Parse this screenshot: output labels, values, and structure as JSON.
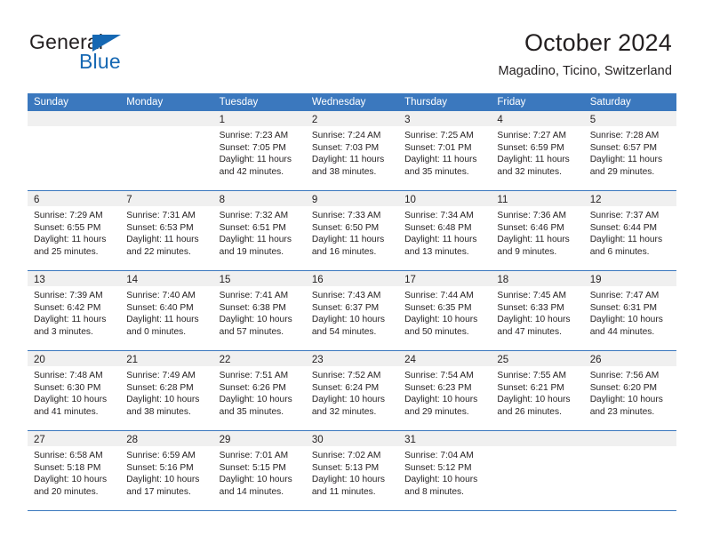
{
  "brand": {
    "name_top": "General",
    "name_bottom": "Blue",
    "accent_color": "#1668b3"
  },
  "header": {
    "title": "October 2024",
    "subtitle": "Magadino, Ticino, Switzerland"
  },
  "theme": {
    "header_row_color": "#3b78be",
    "daynum_band_color": "#f0f0f0",
    "text_color": "#231f20"
  },
  "weekdays": [
    "Sunday",
    "Monday",
    "Tuesday",
    "Wednesday",
    "Thursday",
    "Friday",
    "Saturday"
  ],
  "labels": {
    "sunrise_prefix": "Sunrise:",
    "sunset_prefix": "Sunset:",
    "daylight_prefix": "Daylight:"
  },
  "weeks": [
    [
      {
        "day": "",
        "sunrise": "",
        "sunset": "",
        "daylight_line1": "",
        "daylight_line2": ""
      },
      {
        "day": "",
        "sunrise": "",
        "sunset": "",
        "daylight_line1": "",
        "daylight_line2": ""
      },
      {
        "day": "1",
        "sunrise": "Sunrise: 7:23 AM",
        "sunset": "Sunset: 7:05 PM",
        "daylight_line1": "Daylight: 11 hours",
        "daylight_line2": "and 42 minutes."
      },
      {
        "day": "2",
        "sunrise": "Sunrise: 7:24 AM",
        "sunset": "Sunset: 7:03 PM",
        "daylight_line1": "Daylight: 11 hours",
        "daylight_line2": "and 38 minutes."
      },
      {
        "day": "3",
        "sunrise": "Sunrise: 7:25 AM",
        "sunset": "Sunset: 7:01 PM",
        "daylight_line1": "Daylight: 11 hours",
        "daylight_line2": "and 35 minutes."
      },
      {
        "day": "4",
        "sunrise": "Sunrise: 7:27 AM",
        "sunset": "Sunset: 6:59 PM",
        "daylight_line1": "Daylight: 11 hours",
        "daylight_line2": "and 32 minutes."
      },
      {
        "day": "5",
        "sunrise": "Sunrise: 7:28 AM",
        "sunset": "Sunset: 6:57 PM",
        "daylight_line1": "Daylight: 11 hours",
        "daylight_line2": "and 29 minutes."
      }
    ],
    [
      {
        "day": "6",
        "sunrise": "Sunrise: 7:29 AM",
        "sunset": "Sunset: 6:55 PM",
        "daylight_line1": "Daylight: 11 hours",
        "daylight_line2": "and 25 minutes."
      },
      {
        "day": "7",
        "sunrise": "Sunrise: 7:31 AM",
        "sunset": "Sunset: 6:53 PM",
        "daylight_line1": "Daylight: 11 hours",
        "daylight_line2": "and 22 minutes."
      },
      {
        "day": "8",
        "sunrise": "Sunrise: 7:32 AM",
        "sunset": "Sunset: 6:51 PM",
        "daylight_line1": "Daylight: 11 hours",
        "daylight_line2": "and 19 minutes."
      },
      {
        "day": "9",
        "sunrise": "Sunrise: 7:33 AM",
        "sunset": "Sunset: 6:50 PM",
        "daylight_line1": "Daylight: 11 hours",
        "daylight_line2": "and 16 minutes."
      },
      {
        "day": "10",
        "sunrise": "Sunrise: 7:34 AM",
        "sunset": "Sunset: 6:48 PM",
        "daylight_line1": "Daylight: 11 hours",
        "daylight_line2": "and 13 minutes."
      },
      {
        "day": "11",
        "sunrise": "Sunrise: 7:36 AM",
        "sunset": "Sunset: 6:46 PM",
        "daylight_line1": "Daylight: 11 hours",
        "daylight_line2": "and 9 minutes."
      },
      {
        "day": "12",
        "sunrise": "Sunrise: 7:37 AM",
        "sunset": "Sunset: 6:44 PM",
        "daylight_line1": "Daylight: 11 hours",
        "daylight_line2": "and 6 minutes."
      }
    ],
    [
      {
        "day": "13",
        "sunrise": "Sunrise: 7:39 AM",
        "sunset": "Sunset: 6:42 PM",
        "daylight_line1": "Daylight: 11 hours",
        "daylight_line2": "and 3 minutes."
      },
      {
        "day": "14",
        "sunrise": "Sunrise: 7:40 AM",
        "sunset": "Sunset: 6:40 PM",
        "daylight_line1": "Daylight: 11 hours",
        "daylight_line2": "and 0 minutes."
      },
      {
        "day": "15",
        "sunrise": "Sunrise: 7:41 AM",
        "sunset": "Sunset: 6:38 PM",
        "daylight_line1": "Daylight: 10 hours",
        "daylight_line2": "and 57 minutes."
      },
      {
        "day": "16",
        "sunrise": "Sunrise: 7:43 AM",
        "sunset": "Sunset: 6:37 PM",
        "daylight_line1": "Daylight: 10 hours",
        "daylight_line2": "and 54 minutes."
      },
      {
        "day": "17",
        "sunrise": "Sunrise: 7:44 AM",
        "sunset": "Sunset: 6:35 PM",
        "daylight_line1": "Daylight: 10 hours",
        "daylight_line2": "and 50 minutes."
      },
      {
        "day": "18",
        "sunrise": "Sunrise: 7:45 AM",
        "sunset": "Sunset: 6:33 PM",
        "daylight_line1": "Daylight: 10 hours",
        "daylight_line2": "and 47 minutes."
      },
      {
        "day": "19",
        "sunrise": "Sunrise: 7:47 AM",
        "sunset": "Sunset: 6:31 PM",
        "daylight_line1": "Daylight: 10 hours",
        "daylight_line2": "and 44 minutes."
      }
    ],
    [
      {
        "day": "20",
        "sunrise": "Sunrise: 7:48 AM",
        "sunset": "Sunset: 6:30 PM",
        "daylight_line1": "Daylight: 10 hours",
        "daylight_line2": "and 41 minutes."
      },
      {
        "day": "21",
        "sunrise": "Sunrise: 7:49 AM",
        "sunset": "Sunset: 6:28 PM",
        "daylight_line1": "Daylight: 10 hours",
        "daylight_line2": "and 38 minutes."
      },
      {
        "day": "22",
        "sunrise": "Sunrise: 7:51 AM",
        "sunset": "Sunset: 6:26 PM",
        "daylight_line1": "Daylight: 10 hours",
        "daylight_line2": "and 35 minutes."
      },
      {
        "day": "23",
        "sunrise": "Sunrise: 7:52 AM",
        "sunset": "Sunset: 6:24 PM",
        "daylight_line1": "Daylight: 10 hours",
        "daylight_line2": "and 32 minutes."
      },
      {
        "day": "24",
        "sunrise": "Sunrise: 7:54 AM",
        "sunset": "Sunset: 6:23 PM",
        "daylight_line1": "Daylight: 10 hours",
        "daylight_line2": "and 29 minutes."
      },
      {
        "day": "25",
        "sunrise": "Sunrise: 7:55 AM",
        "sunset": "Sunset: 6:21 PM",
        "daylight_line1": "Daylight: 10 hours",
        "daylight_line2": "and 26 minutes."
      },
      {
        "day": "26",
        "sunrise": "Sunrise: 7:56 AM",
        "sunset": "Sunset: 6:20 PM",
        "daylight_line1": "Daylight: 10 hours",
        "daylight_line2": "and 23 minutes."
      }
    ],
    [
      {
        "day": "27",
        "sunrise": "Sunrise: 6:58 AM",
        "sunset": "Sunset: 5:18 PM",
        "daylight_line1": "Daylight: 10 hours",
        "daylight_line2": "and 20 minutes."
      },
      {
        "day": "28",
        "sunrise": "Sunrise: 6:59 AM",
        "sunset": "Sunset: 5:16 PM",
        "daylight_line1": "Daylight: 10 hours",
        "daylight_line2": "and 17 minutes."
      },
      {
        "day": "29",
        "sunrise": "Sunrise: 7:01 AM",
        "sunset": "Sunset: 5:15 PM",
        "daylight_line1": "Daylight: 10 hours",
        "daylight_line2": "and 14 minutes."
      },
      {
        "day": "30",
        "sunrise": "Sunrise: 7:02 AM",
        "sunset": "Sunset: 5:13 PM",
        "daylight_line1": "Daylight: 10 hours",
        "daylight_line2": "and 11 minutes."
      },
      {
        "day": "31",
        "sunrise": "Sunrise: 7:04 AM",
        "sunset": "Sunset: 5:12 PM",
        "daylight_line1": "Daylight: 10 hours",
        "daylight_line2": "and 8 minutes."
      },
      {
        "day": "",
        "sunrise": "",
        "sunset": "",
        "daylight_line1": "",
        "daylight_line2": ""
      },
      {
        "day": "",
        "sunrise": "",
        "sunset": "",
        "daylight_line1": "",
        "daylight_line2": ""
      }
    ]
  ]
}
